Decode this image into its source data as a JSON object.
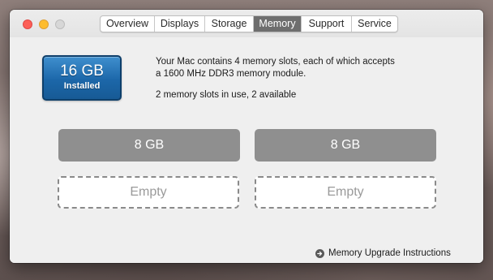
{
  "window": {
    "controls": [
      "close",
      "minimize",
      "zoom"
    ]
  },
  "tabs": [
    {
      "label": "Overview",
      "active": false
    },
    {
      "label": "Displays",
      "active": false
    },
    {
      "label": "Storage",
      "active": false
    },
    {
      "label": "Memory",
      "active": true
    },
    {
      "label": "Support",
      "active": false
    },
    {
      "label": "Service",
      "active": false
    }
  ],
  "memory": {
    "installed_size": "16 GB",
    "installed_label": "Installed",
    "description_line1": "Your Mac contains 4 memory slots, each of which accepts",
    "description_line2": "a 1600 MHz DDR3 memory module.",
    "slots_status": "2 memory slots in use, 2 available",
    "slots": [
      {
        "label": "8 GB",
        "state": "filled"
      },
      {
        "label": "8 GB",
        "state": "filled"
      },
      {
        "label": "Empty",
        "state": "empty"
      },
      {
        "label": "Empty",
        "state": "empty"
      }
    ],
    "upgrade_link": "Memory Upgrade Instructions",
    "upgrade_icon": "arrow-right-circle-icon"
  },
  "colors": {
    "badge_blue": "#1c67a9",
    "active_tab": "#6e6e6e",
    "filled_slot": "#8f8f8f",
    "close": "#fc5f57",
    "minimize": "#fdbc2e"
  }
}
